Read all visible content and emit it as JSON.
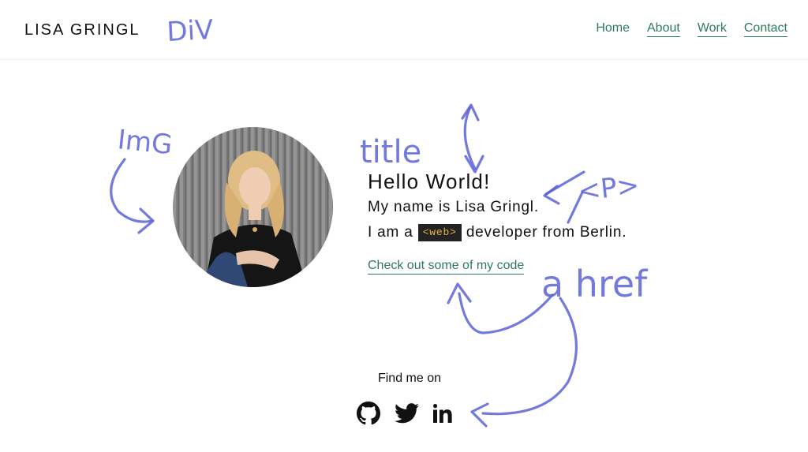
{
  "header": {
    "brand": "LISA GRINGL",
    "nav": [
      "Home",
      "About",
      "Work",
      "Contact"
    ]
  },
  "hero": {
    "title": "Hello World!",
    "line1": "My name is Lisa Gringl.",
    "line2_prefix": "I am a",
    "tag": "<web>",
    "line2_suffix": "developer from Berlin.",
    "link": "Check out some of my code"
  },
  "footer": {
    "find_label": "Find me on",
    "social_icons": [
      "github-icon",
      "twitter-icon",
      "linkedin-icon"
    ]
  },
  "annotations": {
    "div": "DiV",
    "img": "ImG",
    "title": "title",
    "p": "<P>",
    "a_href": "a href"
  },
  "colors": {
    "accent": "#2e7a5a",
    "tag_bg": "#232323",
    "tag_text": "#e7b53b",
    "annotation": "#5b63d6"
  }
}
